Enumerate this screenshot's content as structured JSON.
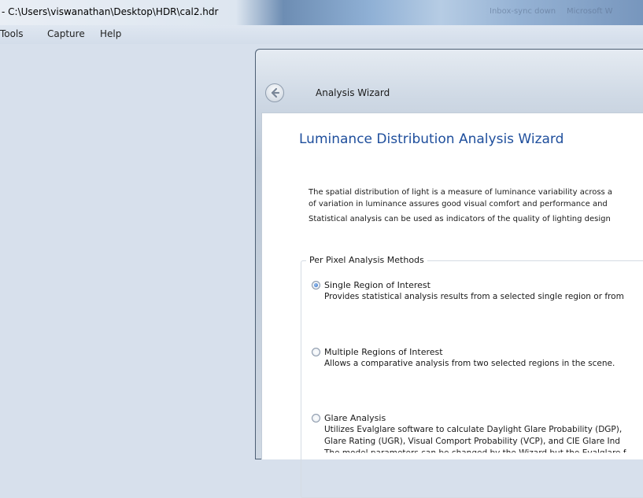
{
  "app": {
    "title": "- C:\\Users\\viswanathan\\Desktop\\HDR\\cal2.hdr",
    "ghost_tabs": [
      "Inbox-sync down",
      "Microsoft W"
    ]
  },
  "menu": [
    "Tools",
    "Capture",
    "Help"
  ],
  "wizard": {
    "window_title": "Analysis Wizard",
    "heading": "Luminance Distribution Analysis Wizard",
    "paragraphs": [
      "The spatial distribution of light is a measure of luminance variability across a",
      "of variation in luminance assures good visual comfort and performance and",
      "Statistical analysis can be used as indicators of the quality of lighting design"
    ],
    "group_label": "Per Pixel Analysis Methods",
    "options": [
      {
        "label": "Single Region of Interest",
        "desc": [
          "Provides statistical analysis results from a selected single region or from"
        ],
        "checked": true
      },
      {
        "label": "Multiple Regions of Interest",
        "desc": [
          "Allows a comparative analysis from two selected regions in the scene."
        ],
        "checked": false
      },
      {
        "label": "Glare Analysis",
        "desc": [
          "Utilizes Evalglare software to calculate Daylight Glare Probability (DGP),",
          "Glare Rating (UGR), Visual Comport Probability (VCP), and CIE Glare Ind",
          "The model parameters can be changed by the Wizard but the Evalglare f"
        ],
        "checked": false
      }
    ]
  },
  "colors": {
    "heading": "#1e4e9c",
    "workspace": "#d7e0ec",
    "titlebar_accent": "#6d8db3"
  }
}
